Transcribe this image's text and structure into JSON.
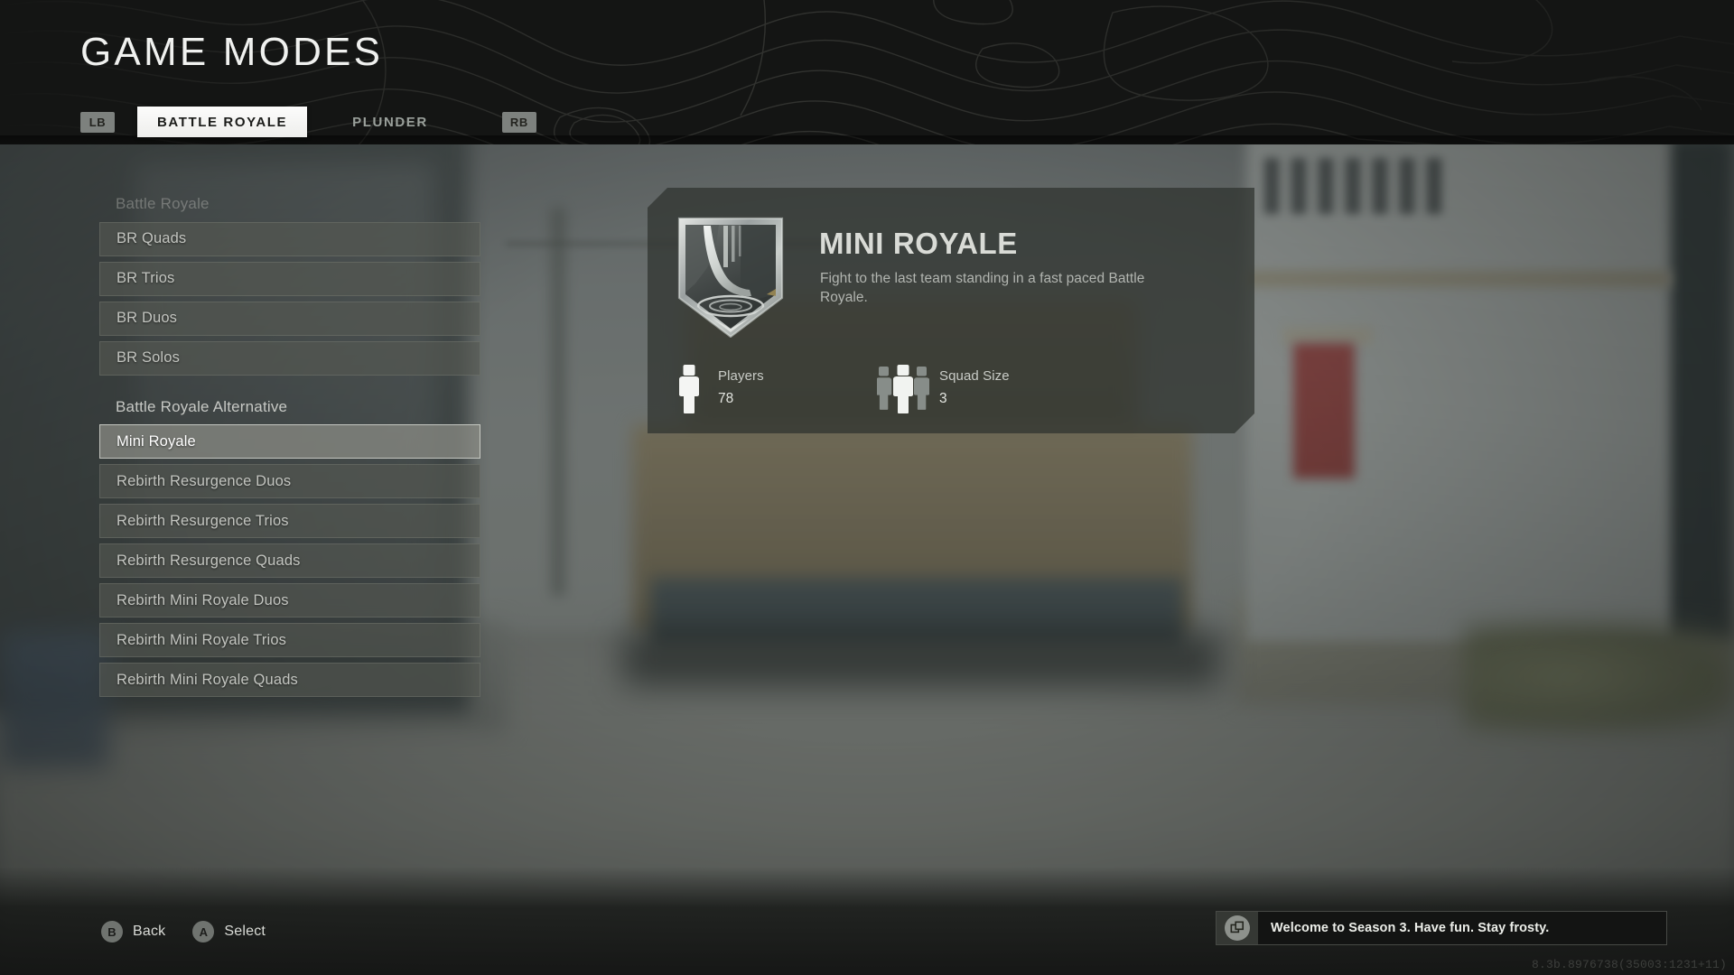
{
  "header": {
    "title": "GAME MODES"
  },
  "tabs": {
    "prev_bumper": "LB",
    "next_bumper": "RB",
    "items": [
      {
        "label": "BATTLE ROYALE",
        "active": true
      },
      {
        "label": "PLUNDER",
        "active": false
      }
    ]
  },
  "mode_list": {
    "sections": [
      {
        "header": "Battle Royale",
        "items": [
          {
            "label": "BR Quads",
            "selected": false
          },
          {
            "label": "BR Trios",
            "selected": false
          },
          {
            "label": "BR Duos",
            "selected": false
          },
          {
            "label": "BR Solos",
            "selected": false
          }
        ]
      },
      {
        "header": "Battle Royale Alternative",
        "items": [
          {
            "label": "Mini Royale",
            "selected": true
          },
          {
            "label": "Rebirth Resurgence Duos",
            "selected": false
          },
          {
            "label": "Rebirth Resurgence Trios",
            "selected": false
          },
          {
            "label": "Rebirth Resurgence Quads",
            "selected": false
          },
          {
            "label": "Rebirth Mini Royale Duos",
            "selected": false
          },
          {
            "label": "Rebirth Mini Royale Trios",
            "selected": false
          },
          {
            "label": "Rebirth Mini Royale Quads",
            "selected": false
          }
        ]
      }
    ]
  },
  "info_panel": {
    "badge_icon": "waterfall-shield-badge",
    "title": "MINI ROYALE",
    "description": "Fight to the last team standing in a fast paced Battle Royale.",
    "stats": [
      {
        "icon": "single-person-icon",
        "label": "Players",
        "value": "78"
      },
      {
        "icon": "three-people-icon",
        "label": "Squad Size",
        "value": "3"
      }
    ]
  },
  "bottom_bar": {
    "hints": [
      {
        "key": "B",
        "label": "Back"
      },
      {
        "key": "A",
        "label": "Select"
      }
    ]
  },
  "toast": {
    "icon": "layers-copy-icon",
    "message": "Welcome to Season 3. Have fun. Stay frosty."
  },
  "debug": {
    "build_string": "8.3b.8976738(35003:1231+11)"
  },
  "colors": {
    "accent_white": "#ffffff",
    "tab_active_bg": "#fcfcfb",
    "tab_active_text": "#1b1c1a",
    "list_item_bg": "#565852",
    "list_item_selected_bg": "#8c8e86",
    "panel_bg": "#2e322e",
    "header_bg": "#141514"
  }
}
